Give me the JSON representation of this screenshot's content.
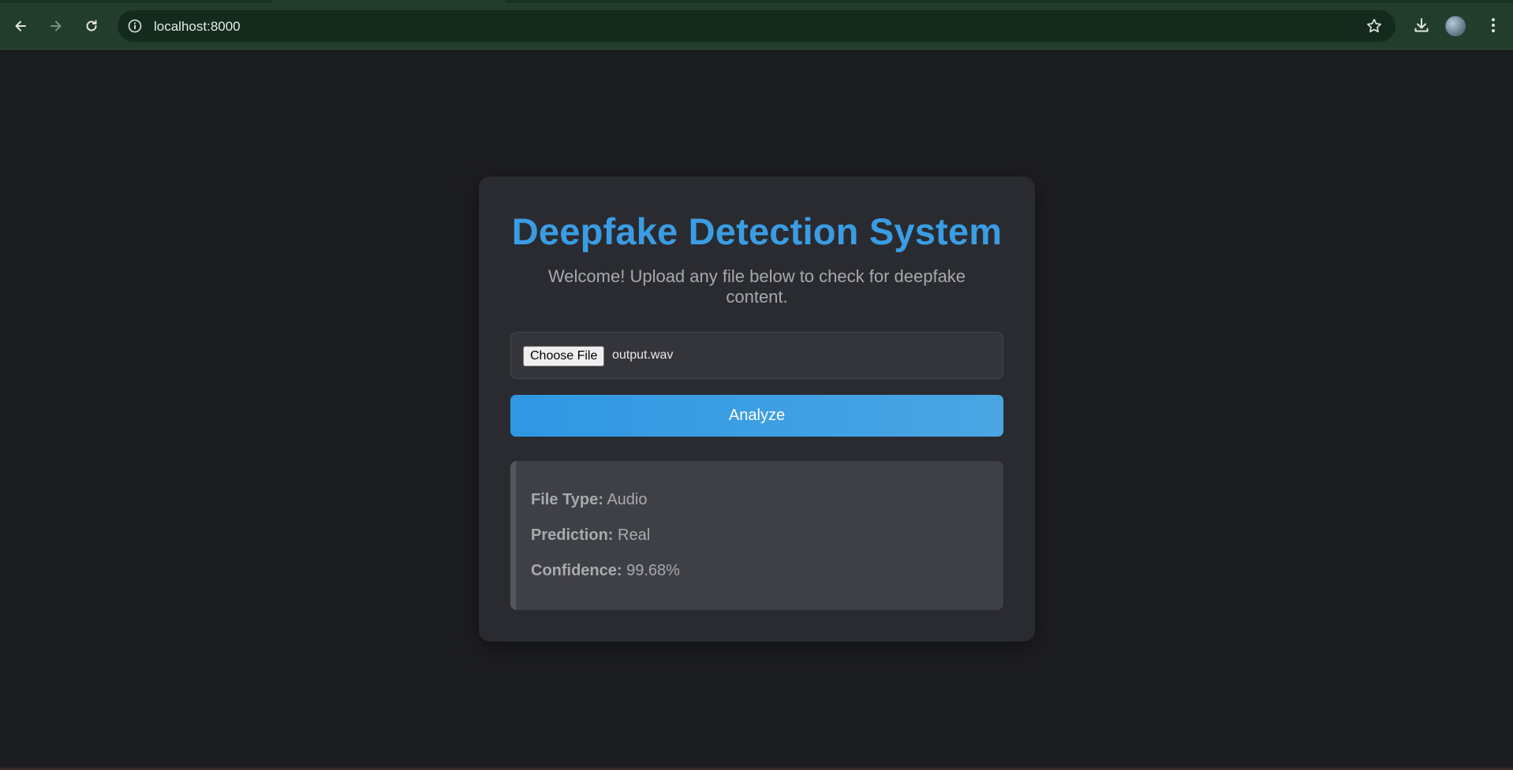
{
  "browser": {
    "url": "localhost:8000",
    "icons": {
      "back": "back-arrow-icon",
      "forward": "forward-arrow-icon",
      "reload": "reload-icon",
      "info": "site-info-icon",
      "bookmark": "star-icon",
      "downloads": "download-icon",
      "menu": "kebab-menu-icon"
    }
  },
  "page": {
    "title": "Deepfake Detection System",
    "subtitle": "Welcome! Upload any file below to check for deepfake content.",
    "file_input": {
      "button_label": "Choose File",
      "selected_file": "output.wav"
    },
    "analyze_label": "Analyze",
    "result": {
      "file_type_label": "File Type:",
      "file_type_value": "Audio",
      "prediction_label": "Prediction:",
      "prediction_value": "Real",
      "confidence_label": "Confidence:",
      "confidence_value": "99.68%"
    }
  },
  "colors": {
    "accent": "#3a9de4",
    "background": "#1c1d21",
    "card": "#2a2b30",
    "browser_frame": "#233d2c"
  }
}
